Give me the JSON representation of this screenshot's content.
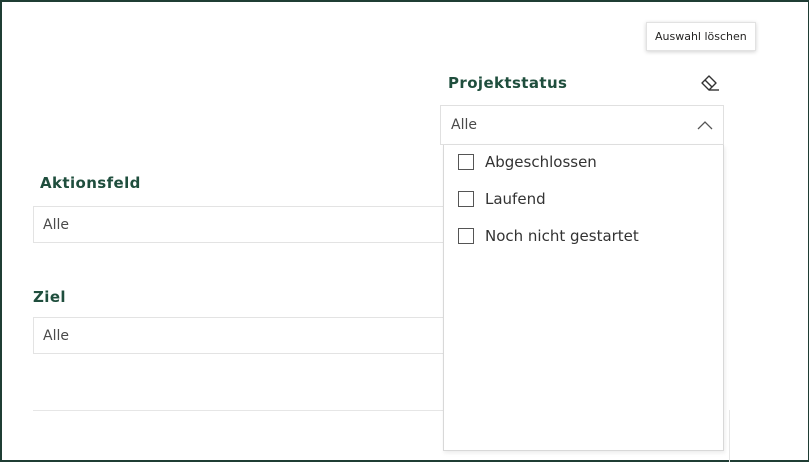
{
  "slicers": {
    "aktionsfeld": {
      "title": "Aktionsfeld",
      "value": "Alle"
    },
    "ziel": {
      "title": "Ziel",
      "value": "Alle"
    },
    "projektstatus": {
      "title": "Projektstatus",
      "value": "Alle",
      "options": [
        {
          "label": "Abgeschlossen",
          "checked": false
        },
        {
          "label": "Laufend",
          "checked": false
        },
        {
          "label": "Noch nicht gestartet",
          "checked": false
        }
      ]
    }
  },
  "tooltip": {
    "text": "Auswahl löschen"
  },
  "icons": {
    "clear_selection": "eraser-icon",
    "dropdown": "chevron-up-icon"
  },
  "colors": {
    "title": "#1f4e3d",
    "frame": "#1f3d34"
  }
}
